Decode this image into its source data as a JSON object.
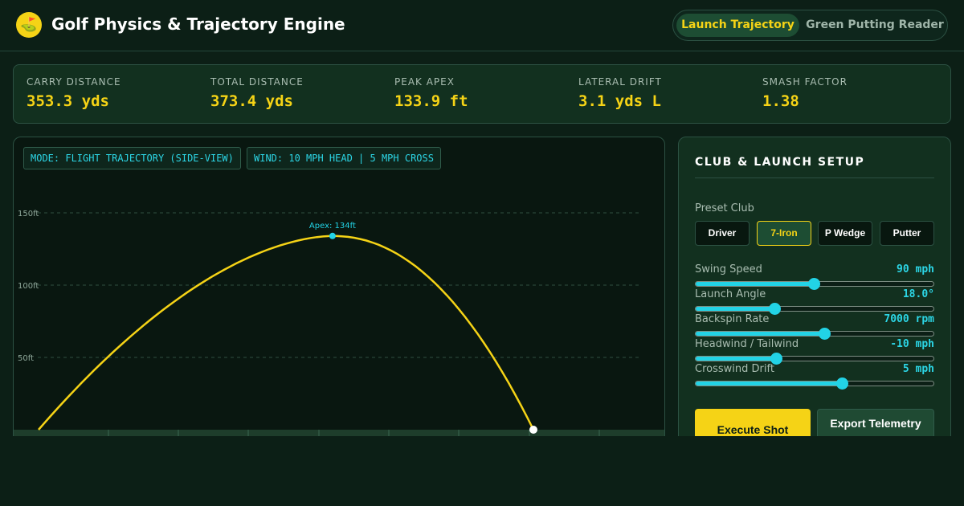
{
  "header": {
    "logo_glyph": "⛳",
    "title": "Golf Physics & Trajectory Engine",
    "tabs": [
      {
        "label": "Launch Trajectory",
        "active": true
      },
      {
        "label": "Green Putting Reader",
        "active": false
      }
    ]
  },
  "stats": [
    {
      "label": "CARRY DISTANCE",
      "value": "353.3 yds"
    },
    {
      "label": "TOTAL DISTANCE",
      "value": "373.4 yds"
    },
    {
      "label": "PEAK APEX",
      "value": "133.9 ft"
    },
    {
      "label": "LATERAL DRIFT",
      "value": "3.1 yds L"
    },
    {
      "label": "SMASH FACTOR",
      "value": "1.38"
    }
  ],
  "viz": {
    "mode_badge": "MODE: FLIGHT TRAJECTORY (SIDE-VIEW)",
    "wind_badge": "WIND: 10 MPH HEAD | 5 MPH CROSS",
    "chart_data": {
      "type": "line",
      "y_ticks": [
        {
          "value": 150,
          "label": "150ft"
        },
        {
          "value": 100,
          "label": "100ft"
        },
        {
          "value": 50,
          "label": "50ft"
        }
      ],
      "ylim": [
        0,
        150
      ],
      "apex_label": "Apex: 134ft",
      "apex_value": 134,
      "apex_fraction": 0.594,
      "grid": true,
      "colors": {
        "trajectory": "#f5d316",
        "apex_marker": "#22d3e6",
        "grid": "#2f4f40",
        "ground": "#1e3d2b"
      }
    }
  },
  "setup": {
    "title": "CLUB & LAUNCH SETUP",
    "preset_label": "Preset Club",
    "clubs": [
      {
        "label": "Driver",
        "active": false
      },
      {
        "label": "7-Iron",
        "active": true
      },
      {
        "label": "P Wedge",
        "active": false
      },
      {
        "label": "Putter",
        "active": false
      }
    ],
    "sliders": [
      {
        "label": "Swing Speed",
        "value": "90 mph",
        "fraction": 0.5
      },
      {
        "label": "Launch Angle",
        "value": "18.0°",
        "fraction": 0.335
      },
      {
        "label": "Backspin Rate",
        "value": "7000 rpm",
        "fraction": 0.545
      },
      {
        "label": "Headwind / Tailwind",
        "value": "-10 mph",
        "fraction": 0.34
      },
      {
        "label": "Crosswind Drift",
        "value": "5 mph",
        "fraction": 0.618
      }
    ],
    "execute_label": "Execute Shot",
    "export_label": "Export Telemetry"
  }
}
